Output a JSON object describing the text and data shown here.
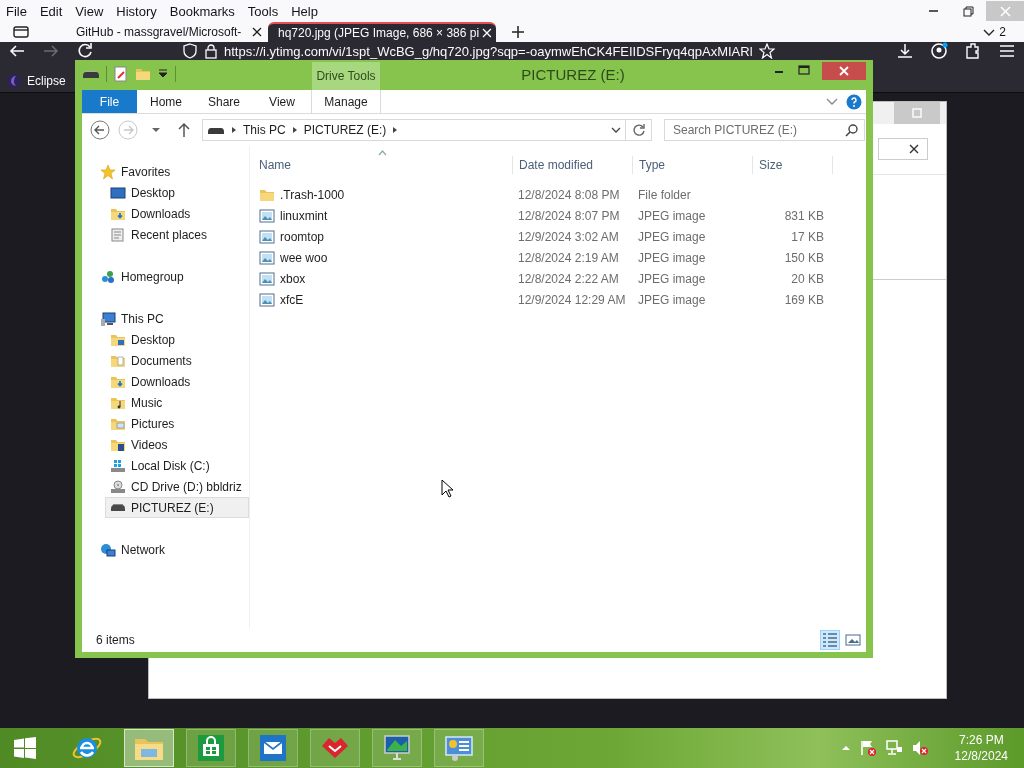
{
  "browser": {
    "menu": [
      "File",
      "Edit",
      "View",
      "History",
      "Bookmarks",
      "Tools",
      "Help"
    ],
    "tabs": [
      {
        "title": "GitHub - massgravel/Microsoft-",
        "selected": false
      },
      {
        "title": "hq720.jpg (JPEG Image, 686 × 386 pi",
        "selected": true
      }
    ],
    "tab_count": "2",
    "forward_disabled": true,
    "address": "https://i.ytimg.com/vi/1spt_WcBG_g/hq720.jpg?sqp=-oaymwEhCK4FEIIDSFryq4qpAxMIARl",
    "bookmarks": [
      "Eclipse"
    ]
  },
  "explorer": {
    "title": "PICTUREZ (E:)",
    "context_tab": "Drive Tools",
    "ribbon_tabs": [
      {
        "label": "File",
        "kind": "file"
      },
      {
        "label": "Home",
        "kind": "tab"
      },
      {
        "label": "Share",
        "kind": "tab"
      },
      {
        "label": "View",
        "kind": "tab"
      },
      {
        "label": "Manage",
        "kind": "context"
      }
    ],
    "forward_disabled": true,
    "breadcrumb": [
      "This PC",
      "PICTUREZ (E:)"
    ],
    "search": {
      "placeholder": "Search PICTUREZ (E:)"
    },
    "nav": [
      {
        "label": "Favorites",
        "kind": "star",
        "selected": false,
        "children": [
          {
            "label": "Desktop",
            "kind": "desktop",
            "selected": false
          },
          {
            "label": "Downloads",
            "kind": "downloads",
            "selected": false
          },
          {
            "label": "Recent places",
            "kind": "recent",
            "selected": false
          }
        ]
      },
      {
        "label": "Homegroup",
        "kind": "homegroup",
        "selected": false
      },
      {
        "label": "This PC",
        "kind": "pc",
        "selected": false,
        "children": [
          {
            "label": "Desktop",
            "kind": "desktop-folder",
            "selected": false
          },
          {
            "label": "Documents",
            "kind": "documents",
            "selected": false
          },
          {
            "label": "Downloads",
            "kind": "downloads",
            "selected": false
          },
          {
            "label": "Music",
            "kind": "music",
            "selected": false
          },
          {
            "label": "Pictures",
            "kind": "pictures",
            "selected": false
          },
          {
            "label": "Videos",
            "kind": "videos",
            "selected": false
          },
          {
            "label": "Local Disk (C:)",
            "kind": "disk",
            "selected": false
          },
          {
            "label": "CD Drive (D:) bbldriz",
            "kind": "cd",
            "selected": false
          },
          {
            "label": "PICTUREZ (E:)",
            "kind": "usb",
            "selected": true
          }
        ]
      },
      {
        "label": "Network",
        "kind": "network",
        "selected": false
      }
    ],
    "columns": [
      "Name",
      "Date modified",
      "Type",
      "Size"
    ],
    "rows": [
      {
        "name": ".Trash-1000",
        "kind": "folder",
        "date": "12/8/2024 8:08 PM",
        "type": "File folder"
      },
      {
        "name": "linuxmint",
        "kind": "image",
        "date": "12/8/2024 8:07 PM",
        "type": "JPEG image",
        "size": "831 KB"
      },
      {
        "name": "roomtop",
        "kind": "image",
        "date": "12/9/2024 3:02 AM",
        "type": "JPEG image",
        "size": "17 KB"
      },
      {
        "name": "wee woo",
        "kind": "image",
        "date": "12/8/2024 2:19 AM",
        "type": "JPEG image",
        "size": "150 KB"
      },
      {
        "name": "xbox",
        "kind": "image",
        "date": "12/8/2024 2:22 AM",
        "type": "JPEG image",
        "size": "20 KB"
      },
      {
        "name": "xfcE",
        "kind": "image",
        "date": "12/9/2024 12:29 AM",
        "type": "JPEG image",
        "size": "169 KB"
      }
    ],
    "status": "6 items",
    "views": [
      {
        "kind": "details",
        "selected": true
      },
      {
        "kind": "thumbnails",
        "selected": false
      }
    ]
  },
  "taskbar": {
    "apps": [
      {
        "kind": "ie",
        "running": false,
        "selected": false
      },
      {
        "kind": "explorer",
        "running": true,
        "selected": true
      },
      {
        "kind": "store",
        "running": true,
        "selected": false
      },
      {
        "kind": "mail",
        "running": true,
        "selected": false
      },
      {
        "kind": "red-app",
        "running": true,
        "selected": false
      },
      {
        "kind": "monitor",
        "running": true,
        "selected": false
      },
      {
        "kind": "control",
        "running": true,
        "selected": false
      }
    ],
    "time": "7:26 PM",
    "date": "12/8/2024"
  }
}
